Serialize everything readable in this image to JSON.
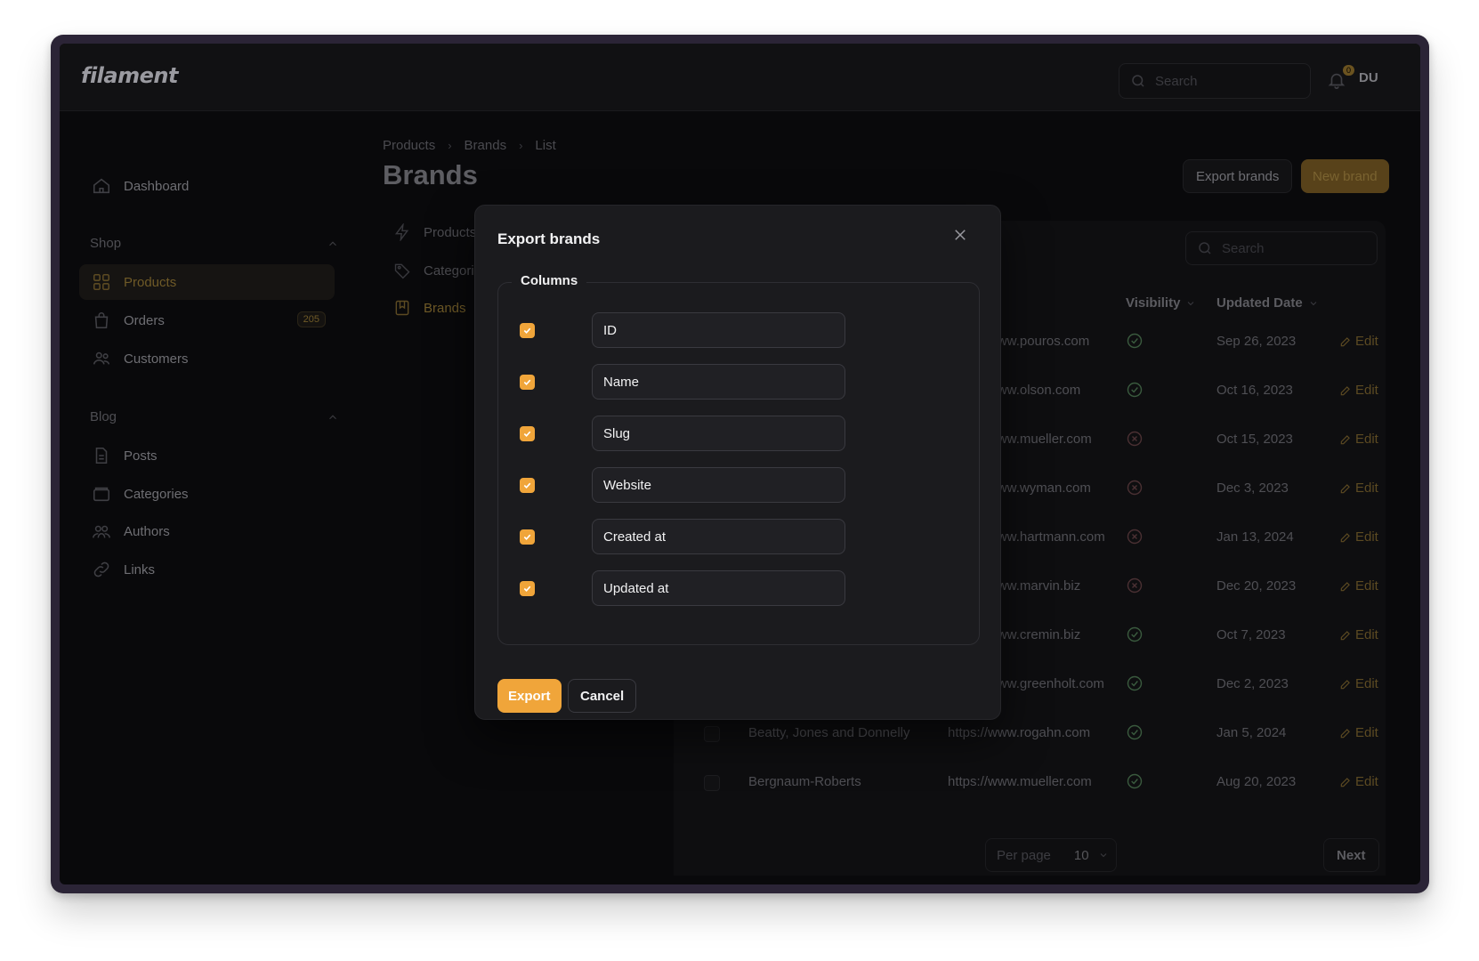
{
  "app": {
    "logo": "filament",
    "search_placeholder": "Search",
    "notifications_count": "0",
    "user_initials": "DU"
  },
  "sidebar": {
    "dashboard": "Dashboard",
    "groups": [
      {
        "label": "Shop",
        "items": [
          {
            "label": "Products",
            "icon": "grid-icon"
          },
          {
            "label": "Orders",
            "icon": "shopping-bag-icon",
            "badge": "205"
          },
          {
            "label": "Customers",
            "icon": "users-icon"
          }
        ]
      },
      {
        "label": "Blog",
        "items": [
          {
            "label": "Posts",
            "icon": "document-icon"
          },
          {
            "label": "Categories",
            "icon": "folder-icon"
          },
          {
            "label": "Authors",
            "icon": "user-group-icon"
          },
          {
            "label": "Links",
            "icon": "link-icon"
          }
        ]
      }
    ]
  },
  "breadcrumb": [
    "Products",
    "Brands",
    "List"
  ],
  "page": {
    "title": "Brands",
    "export_button": "Export brands",
    "new_button": "New brand"
  },
  "subnav": [
    {
      "label": "Products",
      "icon": "bolt-icon"
    },
    {
      "label": "Categories",
      "icon": "tag-icon"
    },
    {
      "label": "Brands",
      "icon": "bookmark-icon"
    }
  ],
  "table": {
    "search_placeholder": "Search",
    "headers": {
      "visibility": "Visibility",
      "updated": "Updated Date"
    },
    "edit_label": "Edit",
    "rows": [
      {
        "name": "",
        "website": "https://www.pouros.com",
        "visible": true,
        "date": "Sep 26, 2023"
      },
      {
        "name": "",
        "website": "https://www.olson.com",
        "visible": true,
        "date": "Oct 16, 2023"
      },
      {
        "name": "",
        "website": "https://www.mueller.com",
        "visible": false,
        "date": "Oct 15, 2023"
      },
      {
        "name": "",
        "website": "https://www.wyman.com",
        "visible": false,
        "date": "Dec 3, 2023"
      },
      {
        "name": "",
        "website": "https://www.hartmann.com",
        "visible": false,
        "date": "Jan 13, 2024"
      },
      {
        "name": "",
        "website": "https://www.marvin.biz",
        "visible": false,
        "date": "Dec 20, 2023"
      },
      {
        "name": "",
        "website": "https://www.cremin.biz",
        "visible": true,
        "date": "Oct 7, 2023"
      },
      {
        "name": "",
        "website": "https://www.greenholt.com",
        "visible": true,
        "date": "Dec 2, 2023"
      },
      {
        "name": "Beatty, Jones and Donnelly",
        "website": "https://www.rogahn.com",
        "visible": true,
        "date": "Jan 5, 2024"
      },
      {
        "name": "Bergnaum-Roberts",
        "website": "https://www.mueller.com",
        "visible": true,
        "date": "Aug 20, 2023"
      }
    ],
    "per_page_label": "Per page",
    "per_page_value": "10",
    "next_label": "Next"
  },
  "modal": {
    "title": "Export brands",
    "columns_legend": "Columns",
    "columns": [
      {
        "label": "ID",
        "checked": true
      },
      {
        "label": "Name",
        "checked": true
      },
      {
        "label": "Slug",
        "checked": true
      },
      {
        "label": "Website",
        "checked": true
      },
      {
        "label": "Created at",
        "checked": true
      },
      {
        "label": "Updated at",
        "checked": true
      }
    ],
    "export_button": "Export",
    "cancel_button": "Cancel"
  },
  "colors": {
    "accent": "#f0a53a",
    "modal_bg": "#1b1b1e",
    "app_bg": "#09090b",
    "frame": "#2b2436"
  }
}
